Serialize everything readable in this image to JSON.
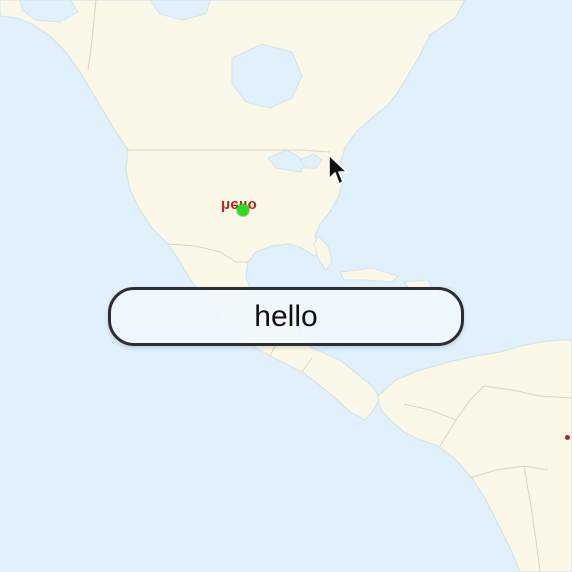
{
  "map": {
    "marker": {
      "label": "hello",
      "dot_color": "#2edb1f",
      "label_color": "#b82626"
    },
    "edge_marker_color": "#b42424"
  },
  "input": {
    "value": "hello"
  },
  "cursor": {
    "icon": "arrow-pointer-icon"
  },
  "colors": {
    "ocean": "#e1f1fb",
    "land": "#fcf8e8",
    "border_line": "#c9c4b4"
  }
}
